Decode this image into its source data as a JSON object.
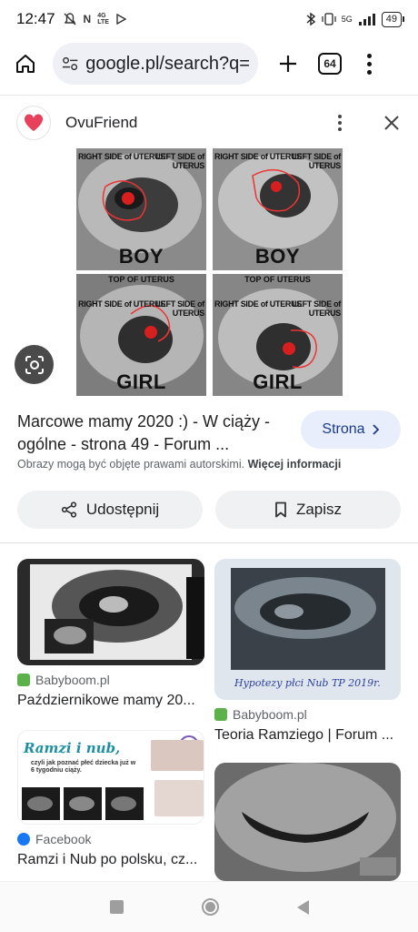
{
  "status_bar": {
    "time": "12:47",
    "left_icons": [
      "notifications-off-icon",
      "nfc-icon",
      "data-saver-icon",
      "play-icon"
    ],
    "network_label": "5G",
    "battery": "49"
  },
  "browser": {
    "url": "google.pl/search?q=m",
    "tab_count": "64"
  },
  "panel": {
    "site_name": "OvuFriend",
    "image_labels": {
      "right_side": "RIGHT SIDE of UTERUS",
      "left_side": "LEFT SIDE of UTERUS",
      "top": "TOP OF UTERUS",
      "boy": "BOY",
      "girl": "GIRL"
    },
    "title": "Marcowe mamy 2020 :) - W ciąży - ogólne - strona 49 - Forum ...",
    "visit_button": "Strona",
    "copyright_text": "Obrazy mogą być objęte prawami autorskimi.",
    "copyright_link": "Więcej informacji",
    "share_label": "Udostępnij",
    "save_label": "Zapisz"
  },
  "results": [
    {
      "source": "Babyboom.pl",
      "title": "Październikowe mamy 20..."
    },
    {
      "source": "Babyboom.pl",
      "title": "Teoria Ramziego | Forum ..."
    },
    {
      "source": "Facebook",
      "title": "Ramzi i Nub po polsku, cz..."
    },
    {
      "source": "",
      "title": ""
    }
  ],
  "ramzi_card": {
    "headline": "Ramzi i nub,",
    "subline": "czyli jak poznać płeć dziecka już w 6 tygodniu ciąży."
  },
  "handwriting": "Hypotezy płci Nub TP 2019r.",
  "colors": {
    "accent_blue": "#e8eefb",
    "babyboom_green": "#5bb14a",
    "facebook_blue": "#1877f2"
  }
}
